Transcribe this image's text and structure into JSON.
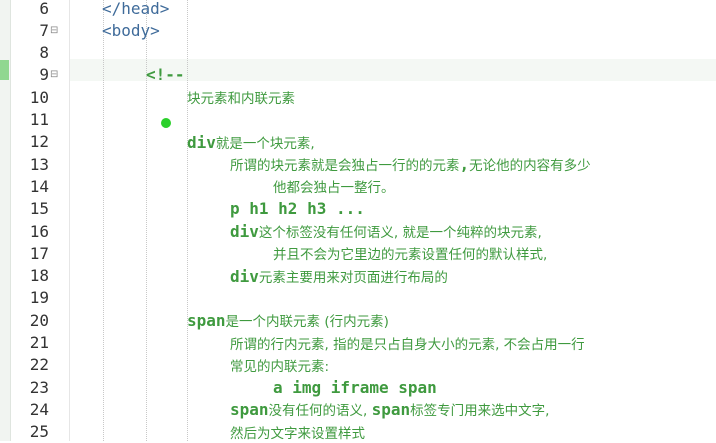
{
  "editor": {
    "lines": [
      {
        "num": "6",
        "text": "</head>",
        "kind": "tag",
        "indent": 102
      },
      {
        "num": "7",
        "text": "<body>",
        "kind": "tag",
        "indent": 102,
        "fold": "⊟"
      },
      {
        "num": "8",
        "text": "",
        "kind": "tag",
        "indent": 102
      },
      {
        "num": "9",
        "text": "<!--",
        "kind": "cm",
        "indent": 146,
        "fold": "⊟"
      },
      {
        "num": "10",
        "parts": [
          {
            "t": "块元素和内联元素",
            "cn": true
          }
        ],
        "indent": 187
      },
      {
        "num": "11",
        "text": "",
        "kind": "cm",
        "indent": 187
      },
      {
        "num": "12",
        "parts": [
          {
            "t": "div",
            "cn": false
          },
          {
            "t": "就是一个块元素,",
            "cn": true
          }
        ],
        "indent": 187
      },
      {
        "num": "13",
        "parts": [
          {
            "t": "所谓的块元素就是会独占一行的的元素",
            "cn": true
          },
          {
            "t": ",",
            "cn": false
          },
          {
            "t": "无论他的内容有多少",
            "cn": true
          }
        ],
        "indent": 230
      },
      {
        "num": "14",
        "parts": [
          {
            "t": "他都会独占一整行。",
            "cn": true
          }
        ],
        "indent": 273
      },
      {
        "num": "15",
        "text": "p h1 h2 h3 ...",
        "kind": "cm",
        "indent": 230
      },
      {
        "num": "16",
        "parts": [
          {
            "t": "div",
            "cn": false
          },
          {
            "t": "这个标签没有任何语义, 就是一个纯粹的块元素,",
            "cn": true
          }
        ],
        "indent": 230
      },
      {
        "num": "17",
        "parts": [
          {
            "t": "并且不会为它里边的元素设置任何的默认样式,",
            "cn": true
          }
        ],
        "indent": 273
      },
      {
        "num": "18",
        "parts": [
          {
            "t": "div",
            "cn": false
          },
          {
            "t": "元素主要用来对页面进行布局的",
            "cn": true
          }
        ],
        "indent": 230
      },
      {
        "num": "19",
        "text": "",
        "kind": "cm",
        "indent": 187
      },
      {
        "num": "20",
        "parts": [
          {
            "t": "span",
            "cn": false
          },
          {
            "t": "是一个内联元素 (行内元素)",
            "cn": true
          }
        ],
        "indent": 187
      },
      {
        "num": "21",
        "parts": [
          {
            "t": "所谓的行内元素, 指的是只占自身大小的元素, 不会占用一行",
            "cn": true
          }
        ],
        "indent": 230
      },
      {
        "num": "22",
        "parts": [
          {
            "t": "常见的内联元素:",
            "cn": true
          }
        ],
        "indent": 230
      },
      {
        "num": "23",
        "text": "a img iframe span",
        "kind": "cm",
        "indent": 273
      },
      {
        "num": "24",
        "parts": [
          {
            "t": "span",
            "cn": false
          },
          {
            "t": "没有任何的语义, ",
            "cn": true
          },
          {
            "t": "span",
            "cn": false
          },
          {
            "t": "标签专门用来选中文字,",
            "cn": true
          }
        ],
        "indent": 230
      },
      {
        "num": "25",
        "parts": [
          {
            "t": "然后为文字来设置样式",
            "cn": true
          }
        ],
        "indent": 230
      }
    ]
  },
  "colors": {
    "tag": "#3f6b9a",
    "comment": "#3f9a3f",
    "marker": "#2bd02b"
  }
}
